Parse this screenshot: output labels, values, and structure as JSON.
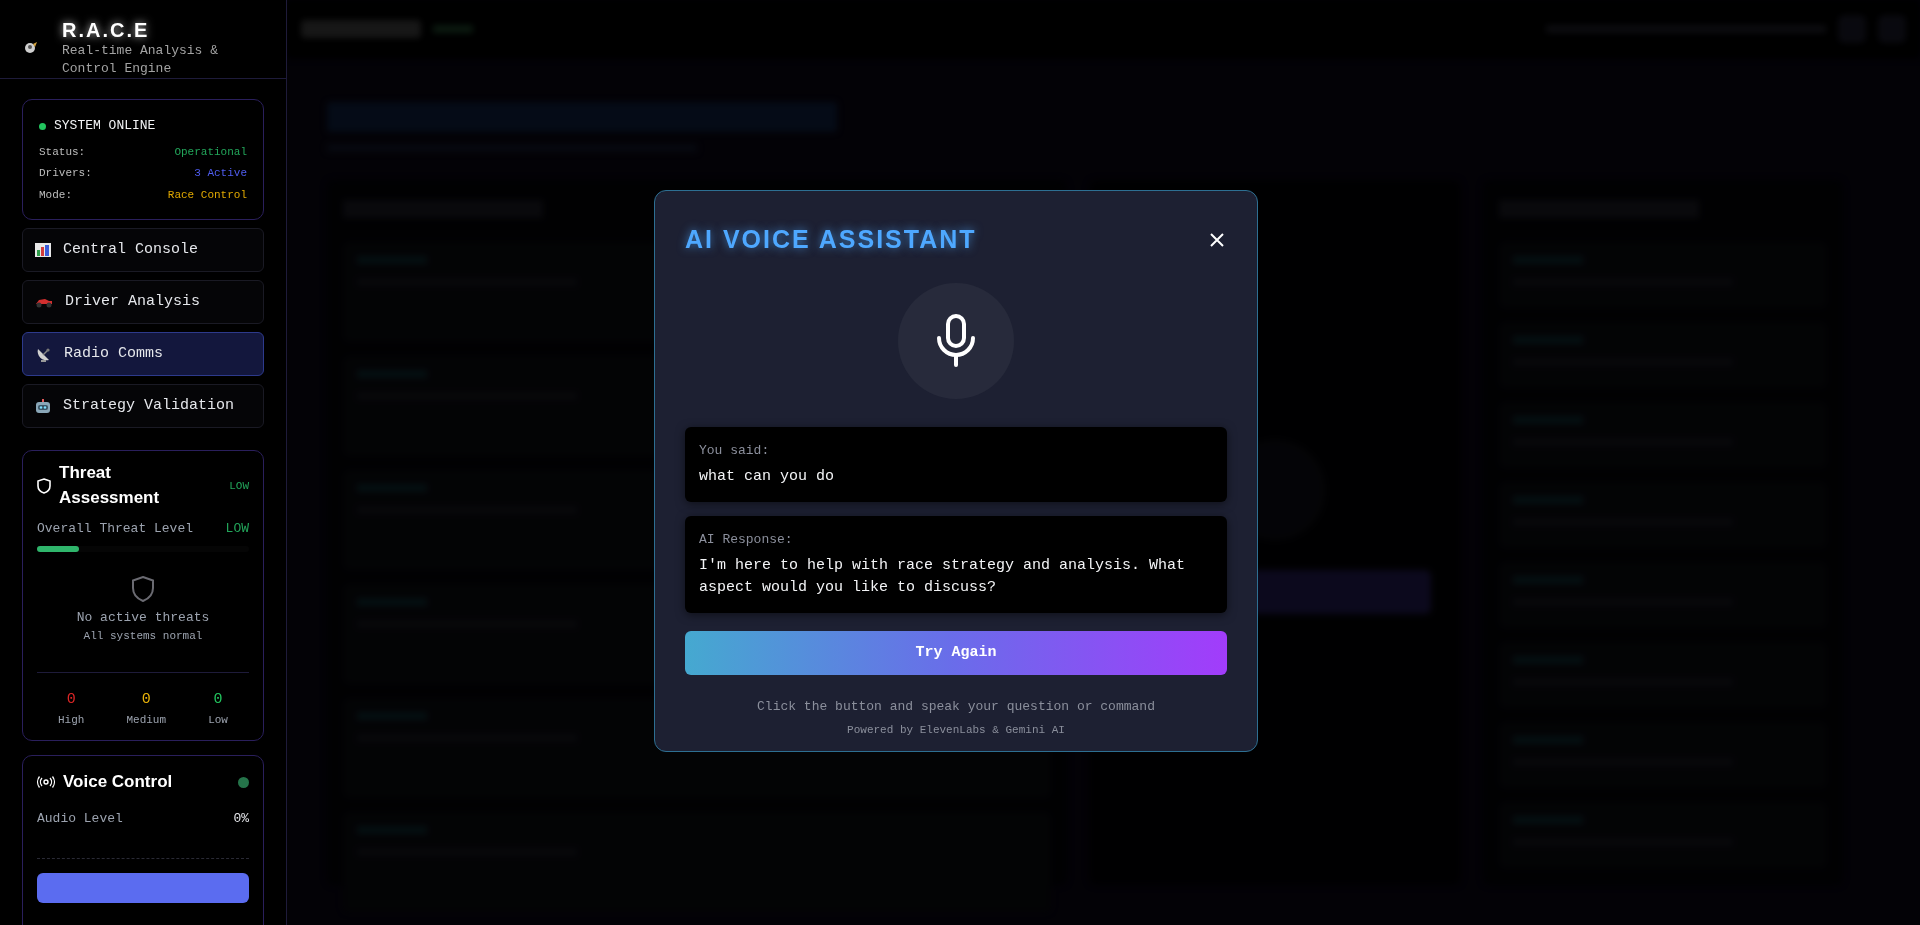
{
  "app": {
    "title": "R.A.C.E",
    "subtitle": "Real-time Analysis & Control Engine"
  },
  "system": {
    "title": "SYSTEM ONLINE",
    "online": true,
    "rows": [
      {
        "label": "Status:",
        "value": "Operational",
        "color": "#22a55a"
      },
      {
        "label": "Drivers:",
        "value": "3 Active",
        "color": "#4f5df0"
      },
      {
        "label": "Mode:",
        "value": "Race Control",
        "color": "#e0a800"
      }
    ]
  },
  "nav": [
    {
      "label": "Central Console",
      "selected": false
    },
    {
      "label": "Driver Analysis",
      "selected": false
    },
    {
      "label": "Radio Comms",
      "selected": true
    },
    {
      "label": "Strategy Validation",
      "selected": false
    }
  ],
  "threat": {
    "title": "Threat Assessment",
    "badge": "LOW",
    "overall_label": "Overall Threat Level",
    "overall_value": "LOW",
    "level": 0.2,
    "empty_title": "No active threats",
    "empty_subtitle": "All systems normal",
    "counts": [
      {
        "value": "0",
        "label": "High",
        "color": "#dc2626"
      },
      {
        "value": "0",
        "label": "Medium",
        "color": "#eab308"
      },
      {
        "value": "0",
        "label": "Low",
        "color": "#22c55e"
      }
    ]
  },
  "voice": {
    "title": "Voice Control",
    "active": true,
    "audio_label": "Audio Level",
    "audio_value": "0%"
  },
  "modal": {
    "title": "AI VOICE ASSISTANT",
    "you_said_label": "You said:",
    "you_said": "what can you do",
    "response_label": "AI Response:",
    "response": "I'm here to help with race strategy and analysis. What aspect would you like to discuss?",
    "button": "Try Again",
    "hint": "Click the button and speak your question or command",
    "footer": "Powered by ElevenLabs & Gemini AI"
  }
}
